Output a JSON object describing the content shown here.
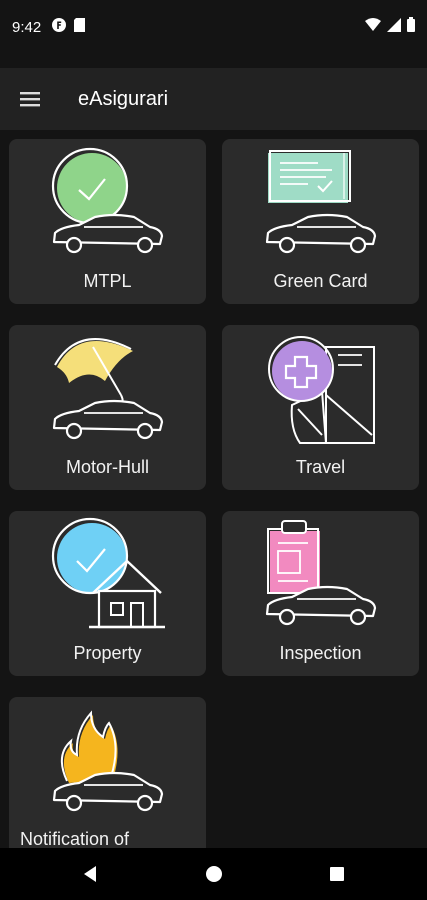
{
  "status": {
    "time": "9:42"
  },
  "appbar": {
    "title": "eAsigurari"
  },
  "cards": [
    {
      "label": "MTPL"
    },
    {
      "label": "Green Card"
    },
    {
      "label": "Motor-Hull"
    },
    {
      "label": "Travel"
    },
    {
      "label": "Property"
    },
    {
      "label": "Inspection"
    },
    {
      "label": "Notification of"
    }
  ],
  "colors": {
    "background": "#141414",
    "appbar": "#222222",
    "card": "#2b2b2b",
    "mtpl_accent": "#8fd48a",
    "greencard_accent": "#9fdcc6",
    "motorhull_accent": "#f5df7a",
    "travel_accent": "#b58ee0",
    "property_accent": "#6fd0f5",
    "inspection_accent": "#f28ac0",
    "fire_accent": "#f5b51e"
  },
  "icons": [
    "menu-icon",
    "back-icon",
    "home-icon",
    "recents-icon",
    "wifi-icon",
    "signal-icon",
    "battery-icon",
    "sim-icon",
    "notification-f-icon"
  ]
}
